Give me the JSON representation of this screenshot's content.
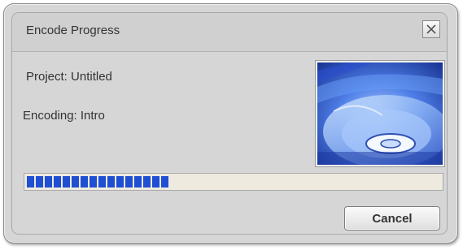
{
  "window": {
    "title": "Encode Progress",
    "close_icon": "close-x-icon"
  },
  "project": {
    "label": "Project: Untitled"
  },
  "encoding": {
    "label": "Encoding: Intro"
  },
  "progress": {
    "fraction": 0.34,
    "color": "#1f4fd3",
    "track_color": "#eeeae0"
  },
  "preview": {
    "icon": "dvd-disc-image"
  },
  "buttons": {
    "cancel_label": "Cancel"
  }
}
